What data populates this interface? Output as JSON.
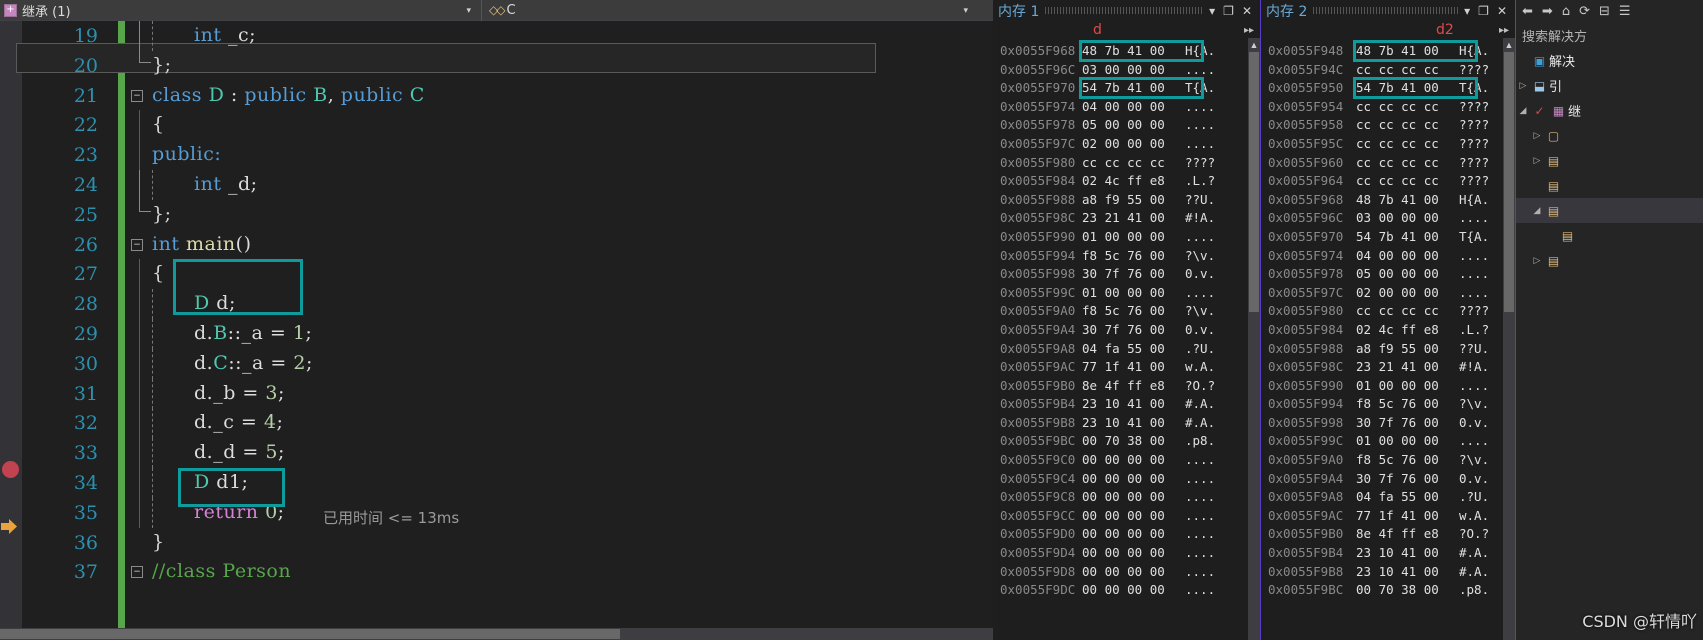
{
  "editor": {
    "nav_left": {
      "icon": "class-member-icon",
      "label": "继承 (1)",
      "caret": "▾"
    },
    "nav_right": {
      "caret": "▾",
      "icon": "cpp-file-icon",
      "label": "C"
    },
    "lines": [
      {
        "no": "19",
        "text": "int _c;"
      },
      {
        "no": "20",
        "text": "};"
      },
      {
        "no": "21",
        "text": "class D : public B, public C"
      },
      {
        "no": "22",
        "text": "{"
      },
      {
        "no": "23",
        "text": "public:"
      },
      {
        "no": "24",
        "text": "int _d;"
      },
      {
        "no": "25",
        "text": "};"
      },
      {
        "no": "26",
        "text": "int main()"
      },
      {
        "no": "27",
        "text": "{"
      },
      {
        "no": "28",
        "text": "D d;"
      },
      {
        "no": "29",
        "text": "d.B::_a = 1;"
      },
      {
        "no": "30",
        "text": "d.C::_a = 2;"
      },
      {
        "no": "31",
        "text": "d._b = 3;"
      },
      {
        "no": "32",
        "text": "d._c = 4;"
      },
      {
        "no": "33",
        "text": "d._d = 5;"
      },
      {
        "no": "34",
        "text": "D d1;"
      },
      {
        "no": "35",
        "text": "return 0;"
      },
      {
        "no": "36",
        "text": "}"
      },
      {
        "no": "37",
        "text": "//class Person"
      }
    ],
    "tokens": {
      "l19_int": "int",
      "l19_var": "_c;",
      "l20": "};",
      "l21_class": "class",
      "l21_D": "D",
      "l21_colon": " : ",
      "l21_pub1": "public",
      "l21_B": "B",
      "l21_comma": ", ",
      "l21_pub2": "public",
      "l21_C": "C",
      "l22": "{",
      "l23": "public:",
      "l24_int": "int",
      "l24_var": "_d;",
      "l25": "};",
      "l26_int": "int",
      "l26_main": "main",
      "l26_paren": "()",
      "l27": "{",
      "l28_D": "D",
      "l28_d": "d;",
      "l29": "d.",
      "l29_B": "B",
      "l29_rest": "::_a = ",
      "l29_num": "1",
      "l29_semi": ";",
      "l30": "d.",
      "l30_C": "C",
      "l30_rest": "::_a = ",
      "l30_num": "2",
      "l30_semi": ";",
      "l31": "d._b = ",
      "l31_num": "3",
      "l31_semi": ";",
      "l32": "d._c = ",
      "l32_num": "4",
      "l32_semi": ";",
      "l33": "d._d = ",
      "l33_num": "5",
      "l33_semi": ";",
      "l34_D": "D",
      "l34_d": "d1;",
      "l35_return": "return",
      "l35_num": " 0",
      "l35_semi": ";",
      "l35_time": "已用时间 <= 13ms",
      "l36": "}",
      "l37": "//class Person"
    }
  },
  "memory1": {
    "title": "内存 1",
    "varname": "d",
    "controls": {
      "pin": "▾",
      "dock": "❐",
      "close": "✕"
    },
    "scroll_more": "▸▸",
    "rows": [
      {
        "addr": "0x0055F968",
        "hex": "48 7b 41 00",
        "asc": "H{A."
      },
      {
        "addr": "0x0055F96C",
        "hex": "03 00 00 00",
        "asc": "...."
      },
      {
        "addr": "0x0055F970",
        "hex": "54 7b 41 00",
        "asc": "T{A."
      },
      {
        "addr": "0x0055F974",
        "hex": "04 00 00 00",
        "asc": "...."
      },
      {
        "addr": "0x0055F978",
        "hex": "05 00 00 00",
        "asc": "...."
      },
      {
        "addr": "0x0055F97C",
        "hex": "02 00 00 00",
        "asc": "...."
      },
      {
        "addr": "0x0055F980",
        "hex": "cc cc cc cc",
        "asc": "????"
      },
      {
        "addr": "0x0055F984",
        "hex": "02 4c ff e8",
        "asc": ".L.?"
      },
      {
        "addr": "0x0055F988",
        "hex": "a8 f9 55 00",
        "asc": "??U."
      },
      {
        "addr": "0x0055F98C",
        "hex": "23 21 41 00",
        "asc": "#!A."
      },
      {
        "addr": "0x0055F990",
        "hex": "01 00 00 00",
        "asc": "...."
      },
      {
        "addr": "0x0055F994",
        "hex": "f8 5c 76 00",
        "asc": "?\\v."
      },
      {
        "addr": "0x0055F998",
        "hex": "30 7f 76 00",
        "asc": "0.v."
      },
      {
        "addr": "0x0055F99C",
        "hex": "01 00 00 00",
        "asc": "...."
      },
      {
        "addr": "0x0055F9A0",
        "hex": "f8 5c 76 00",
        "asc": "?\\v."
      },
      {
        "addr": "0x0055F9A4",
        "hex": "30 7f 76 00",
        "asc": "0.v."
      },
      {
        "addr": "0x0055F9A8",
        "hex": "04 fa 55 00",
        "asc": ".?U."
      },
      {
        "addr": "0x0055F9AC",
        "hex": "77 1f 41 00",
        "asc": "w.A."
      },
      {
        "addr": "0x0055F9B0",
        "hex": "8e 4f ff e8",
        "asc": "?O.?"
      },
      {
        "addr": "0x0055F9B4",
        "hex": "23 10 41 00",
        "asc": "#.A."
      },
      {
        "addr": "0x0055F9B8",
        "hex": "23 10 41 00",
        "asc": "#.A."
      },
      {
        "addr": "0x0055F9BC",
        "hex": "00 70 38 00",
        "asc": ".p8."
      },
      {
        "addr": "0x0055F9C0",
        "hex": "00 00 00 00",
        "asc": "...."
      },
      {
        "addr": "0x0055F9C4",
        "hex": "00 00 00 00",
        "asc": "...."
      },
      {
        "addr": "0x0055F9C8",
        "hex": "00 00 00 00",
        "asc": "...."
      },
      {
        "addr": "0x0055F9CC",
        "hex": "00 00 00 00",
        "asc": "...."
      },
      {
        "addr": "0x0055F9D0",
        "hex": "00 00 00 00",
        "asc": "...."
      },
      {
        "addr": "0x0055F9D4",
        "hex": "00 00 00 00",
        "asc": "...."
      },
      {
        "addr": "0x0055F9D8",
        "hex": "00 00 00 00",
        "asc": "...."
      },
      {
        "addr": "0x0055F9DC",
        "hex": "00 00 00 00",
        "asc": "...."
      }
    ],
    "highlight_rows": [
      0,
      2
    ]
  },
  "memory2": {
    "title": "内存 2",
    "varname": "d2",
    "controls": {
      "pin": "▾",
      "dock": "❐",
      "close": "✕"
    },
    "scroll_more": "▸▸",
    "rows": [
      {
        "addr": "0x0055F948",
        "hex": "48 7b 41 00",
        "asc": "H{A."
      },
      {
        "addr": "0x0055F94C",
        "hex": "cc cc cc cc",
        "asc": "????"
      },
      {
        "addr": "0x0055F950",
        "hex": "54 7b 41 00",
        "asc": "T{A."
      },
      {
        "addr": "0x0055F954",
        "hex": "cc cc cc cc",
        "asc": "????"
      },
      {
        "addr": "0x0055F958",
        "hex": "cc cc cc cc",
        "asc": "????"
      },
      {
        "addr": "0x0055F95C",
        "hex": "cc cc cc cc",
        "asc": "????"
      },
      {
        "addr": "0x0055F960",
        "hex": "cc cc cc cc",
        "asc": "????"
      },
      {
        "addr": "0x0055F964",
        "hex": "cc cc cc cc",
        "asc": "????"
      },
      {
        "addr": "0x0055F968",
        "hex": "48 7b 41 00",
        "asc": "H{A."
      },
      {
        "addr": "0x0055F96C",
        "hex": "03 00 00 00",
        "asc": "...."
      },
      {
        "addr": "0x0055F970",
        "hex": "54 7b 41 00",
        "asc": "T{A."
      },
      {
        "addr": "0x0055F974",
        "hex": "04 00 00 00",
        "asc": "...."
      },
      {
        "addr": "0x0055F978",
        "hex": "05 00 00 00",
        "asc": "...."
      },
      {
        "addr": "0x0055F97C",
        "hex": "02 00 00 00",
        "asc": "...."
      },
      {
        "addr": "0x0055F980",
        "hex": "cc cc cc cc",
        "asc": "????"
      },
      {
        "addr": "0x0055F984",
        "hex": "02 4c ff e8",
        "asc": ".L.?"
      },
      {
        "addr": "0x0055F988",
        "hex": "a8 f9 55 00",
        "asc": "??U."
      },
      {
        "addr": "0x0055F98C",
        "hex": "23 21 41 00",
        "asc": "#!A."
      },
      {
        "addr": "0x0055F990",
        "hex": "01 00 00 00",
        "asc": "...."
      },
      {
        "addr": "0x0055F994",
        "hex": "f8 5c 76 00",
        "asc": "?\\v."
      },
      {
        "addr": "0x0055F998",
        "hex": "30 7f 76 00",
        "asc": "0.v."
      },
      {
        "addr": "0x0055F99C",
        "hex": "01 00 00 00",
        "asc": "...."
      },
      {
        "addr": "0x0055F9A0",
        "hex": "f8 5c 76 00",
        "asc": "?\\v."
      },
      {
        "addr": "0x0055F9A4",
        "hex": "30 7f 76 00",
        "asc": "0.v."
      },
      {
        "addr": "0x0055F9A8",
        "hex": "04 fa 55 00",
        "asc": ".?U."
      },
      {
        "addr": "0x0055F9AC",
        "hex": "77 1f 41 00",
        "asc": "w.A."
      },
      {
        "addr": "0x0055F9B0",
        "hex": "8e 4f ff e8",
        "asc": "?O.?"
      },
      {
        "addr": "0x0055F9B4",
        "hex": "23 10 41 00",
        "asc": "#.A."
      },
      {
        "addr": "0x0055F9B8",
        "hex": "23 10 41 00",
        "asc": "#.A."
      },
      {
        "addr": "0x0055F9BC",
        "hex": "00 70 38 00",
        "asc": ".p8."
      }
    ],
    "highlight_rows": [
      0,
      2
    ]
  },
  "sidebar": {
    "toolbar": [
      "back-icon",
      "forward-icon",
      "home-icon",
      "refresh-icon",
      "collapse-icon",
      "properties-icon"
    ],
    "toolbar_glyphs": [
      "←",
      "→",
      "⌂",
      "⟳",
      "⊟",
      "☰"
    ],
    "search_placeholder": "搜索解决方",
    "tree": [
      {
        "twisty": "",
        "icon": "solution-icon",
        "label": "解决"
      },
      {
        "twisty": "▷",
        "icon": "references-icon",
        "label": "引"
      },
      {
        "twisty": "◢",
        "icon": "project-icon",
        "label": "继"
      },
      {
        "twisty": "▷",
        "icon": "folder-icon",
        "label": ""
      },
      {
        "twisty": "▷",
        "icon": "folder-icon",
        "label": ""
      },
      {
        "twisty": "",
        "icon": "folder-icon",
        "label": ""
      },
      {
        "twisty": "◢",
        "icon": "folder-icon",
        "label": ""
      },
      {
        "twisty": "",
        "icon": "file-icon",
        "label": ""
      },
      {
        "twisty": "▷",
        "icon": "file-icon",
        "label": ""
      }
    ]
  },
  "watermark": "CSDN @轩情吖"
}
